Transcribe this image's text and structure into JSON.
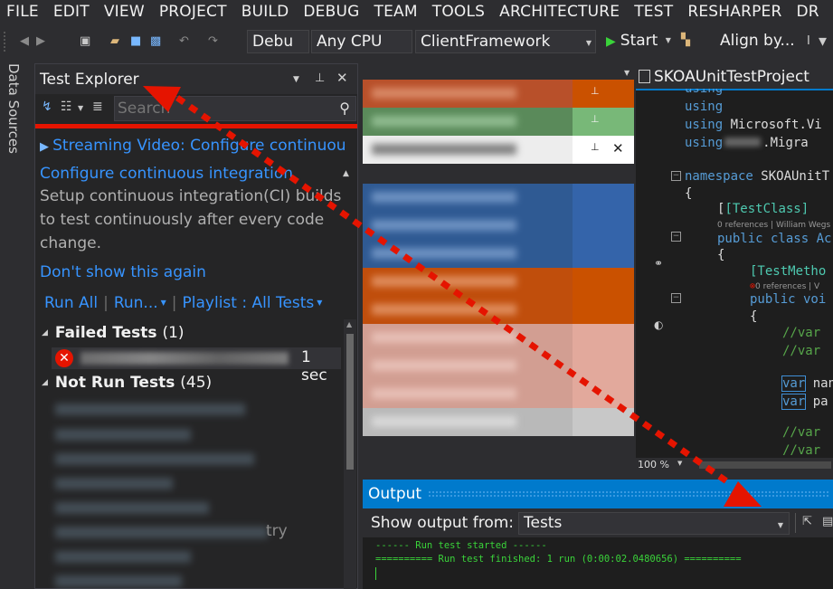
{
  "menu": [
    "FILE",
    "EDIT",
    "VIEW",
    "PROJECT",
    "BUILD",
    "DEBUG",
    "TEAM",
    "TOOLS",
    "ARCHITECTURE",
    "TEST",
    "RESHARPER",
    "DR"
  ],
  "toolbar": {
    "config": "Debu",
    "platform": "Any CPU",
    "project": "ClientFramework",
    "start": "Start",
    "align": "Align by..."
  },
  "side_tab": "Data Sources",
  "test_explorer": {
    "title": "Test Explorer",
    "search_placeholder": "Search",
    "notice_link": "Streaming Video: Configure continuou",
    "heading_link": "Configure continuous integration",
    "description": "Setup continuous integration(CI) builds to test continuously after every code change.",
    "dismiss_link": "Don't show this again",
    "run_all": "Run All",
    "run": "Run...",
    "playlist": "Playlist : All Tests",
    "failed_label": "Failed Tests",
    "failed_count": "(1)",
    "failed_time": "1 sec",
    "notrun_label": "Not Run Tests",
    "notrun_count": "(45)",
    "partial_item_tail": "try"
  },
  "editor": {
    "tab_title": "SKOAUnitTestProject",
    "zoom": "100 %",
    "lines": {
      "using1": "using",
      "using2": "using",
      "using3a": "using",
      "using3b": " Microsoft.Vi",
      "using4a": "using",
      "using4b": ".Migra",
      "ns_kw": "namespace",
      "ns_name": " SKOAUnitT",
      "brace1": "{",
      "attr1": "[TestClass]",
      "refs1": "0 references | William Wegs",
      "class_line": "public class Ac",
      "brace2": "{",
      "attr2": "[TestMetho",
      "refs2": "0 references | V",
      "method_line": "public voi",
      "brace3": "{",
      "c1": "//var",
      "c2": "//var",
      "v1a": "var",
      "v1b": " nan",
      "v2a": "var",
      "v2b": " pa",
      "c3": "//var",
      "c4": "//var"
    }
  },
  "output": {
    "title": "Output",
    "show_label": "Show output from:",
    "source": "Tests",
    "line1": "------ Run test started ------",
    "line2": "========== Run test finished: 1 run (0:00:02.0480656) =========="
  },
  "colors": {
    "accent": "#007acc",
    "error": "#e51400",
    "link": "#3794ff",
    "console": "#3ad33a",
    "annotation_arrow": "#e51400"
  }
}
